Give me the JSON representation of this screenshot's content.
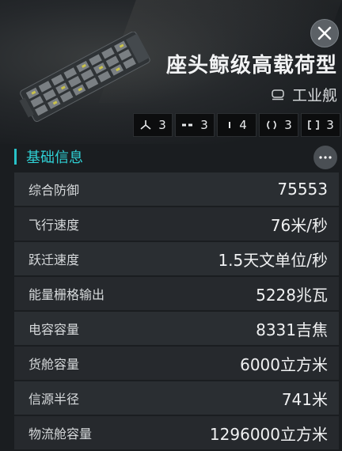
{
  "ship": {
    "name": "座头鲸级高载荷型",
    "class_label": "工业舰"
  },
  "slots": [
    {
      "icon": "high-slot-icon",
      "count": "3"
    },
    {
      "icon": "mid-slot-icon",
      "count": "3"
    },
    {
      "icon": "low-slot-icon",
      "count": "4"
    },
    {
      "icon": "rig-slot-icon",
      "count": "3"
    },
    {
      "icon": "subsystem-slot-icon",
      "count": "3"
    }
  ],
  "section": {
    "title": "基础信息"
  },
  "stats": [
    {
      "label": "综合防御",
      "value": "75553"
    },
    {
      "label": "飞行速度",
      "value": "76米/秒"
    },
    {
      "label": "跃迁速度",
      "value": "1.5天文单位/秒"
    },
    {
      "label": "能量栅格输出",
      "value": "5228兆瓦"
    },
    {
      "label": "电容容量",
      "value": "8331吉焦"
    },
    {
      "label": "货舱容量",
      "value": "6000立方米"
    },
    {
      "label": "信源半径",
      "value": "741米"
    },
    {
      "label": "物流舱容量",
      "value": "1296000立方米"
    }
  ],
  "colors": {
    "accent": "#2fd0d4",
    "background": "#1a1d20"
  }
}
